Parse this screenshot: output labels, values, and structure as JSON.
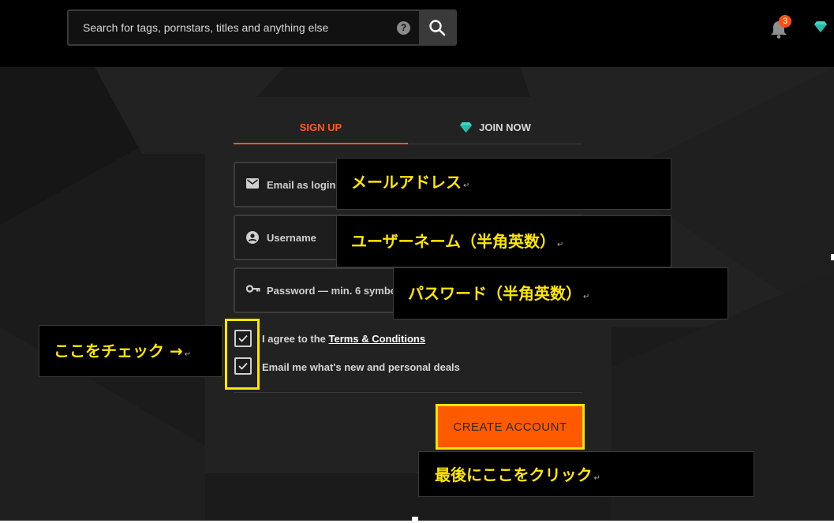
{
  "header": {
    "search_placeholder": "Search for tags, pornstars, titles and anything else",
    "help_label": "?",
    "notification_count": "3"
  },
  "tabs": {
    "signup": "SIGN UP",
    "join": "JOIN NOW"
  },
  "form": {
    "email_placeholder": "Email as login",
    "username_placeholder": "Username",
    "password_placeholder": "Password — min. 6 symbols",
    "agree_prefix": "I agree to the ",
    "terms_link": "Terms & Conditions",
    "email_opt": "Email me what's new and personal deals",
    "create_button": "CREATE ACCOUNT"
  },
  "annotations": {
    "email": "メールアドレス",
    "username": "ユーザーネーム（半角英数）",
    "password": "パスワード（半角英数）",
    "check": "ここをチェック →",
    "final": "最後にここをクリック"
  },
  "colors": {
    "accent": "#ff5a1f",
    "button": "#ff5a00",
    "highlight": "#ffe600",
    "diamond": "#3fd8c8"
  },
  "icons": [
    "search-icon",
    "help-icon",
    "bell-icon",
    "diamond-icon",
    "mail-icon",
    "user-icon",
    "key-icon",
    "check-icon"
  ]
}
